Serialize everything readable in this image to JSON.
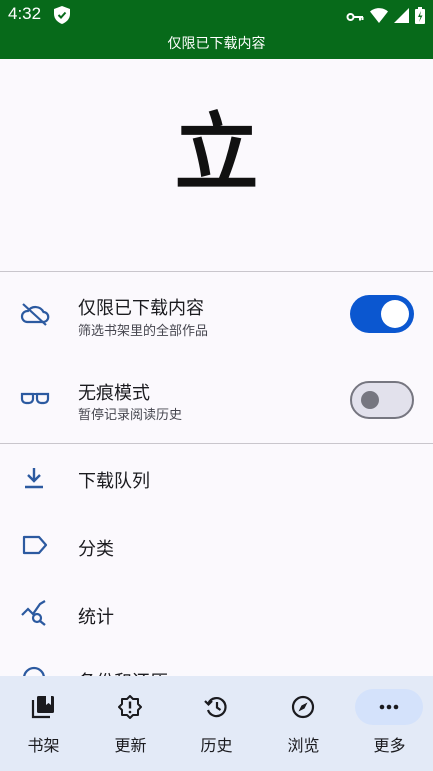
{
  "status_bar": {
    "time": "4:32"
  },
  "banner": {
    "text": "仅限已下载内容"
  },
  "logo": {
    "glyph": "立"
  },
  "settings": {
    "downloaded_only": {
      "title": "仅限已下载内容",
      "subtitle": "筛选书架里的全部作品",
      "enabled": true
    },
    "incognito": {
      "title": "无痕模式",
      "subtitle": "暂停记录阅读历史",
      "enabled": false
    }
  },
  "menu": [
    {
      "label": "下载队列",
      "icon": "download-icon"
    },
    {
      "label": "分类",
      "icon": "label-icon"
    },
    {
      "label": "统计",
      "icon": "stats-icon"
    },
    {
      "label": "备份和还原",
      "icon": "backup-icon"
    }
  ],
  "bottom_nav": [
    {
      "label": "书架",
      "icon": "library-icon",
      "active": false
    },
    {
      "label": "更新",
      "icon": "updates-icon",
      "active": false
    },
    {
      "label": "历史",
      "icon": "history-icon",
      "active": false
    },
    {
      "label": "浏览",
      "icon": "compass-icon",
      "active": false
    },
    {
      "label": "更多",
      "icon": "more-icon",
      "active": true
    }
  ],
  "colors": {
    "status_bar": "#076a1a",
    "accent": "#0b57d0",
    "nav_bg": "#e3eaf7"
  }
}
